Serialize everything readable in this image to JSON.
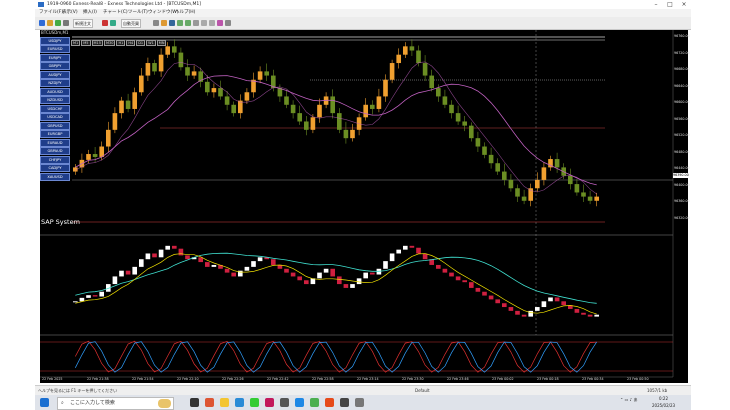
{
  "window": {
    "title": "1919-0960 Exness-Real8 - Exness Technologies Ltd - [BTCUSDm,M1]"
  },
  "menu": [
    "ファイル(F)",
    "表示(V)",
    "挿入(I)",
    "チャート(C)",
    "ツール(T)",
    "ウィンドウ(W)",
    "ヘルプ(H)"
  ],
  "toolbar": {
    "new_order": "新規注文",
    "auto_trade": "自動売買"
  },
  "chart": {
    "symbol_header": "BTCUSDm,M1",
    "overlay_label": "SAP System",
    "timeframes": [
      "M1",
      "M5",
      "M15",
      "M30",
      "H1",
      "H4",
      "D1",
      "W1",
      "MN"
    ],
    "symbols": [
      "USDJPY",
      "EURUSD",
      "EURJPY",
      "GBPJPY",
      "AUDJPY",
      "NZDJPY",
      "AUDUSD",
      "NZDUSD",
      "USDCHF",
      "USDCAD",
      "GBPUSD",
      "EURGBP",
      "EURAUD",
      "GBPAUD",
      "CHFJPY",
      "CADJPY",
      "XAUUSD"
    ],
    "price_ticks": [
      "96760.00",
      "96720.00",
      "96680.00",
      "96640.00",
      "96600.00",
      "96560.00",
      "96520.00",
      "96480.00",
      "96440.00",
      "96400.00",
      "96360.00",
      "96320.00"
    ],
    "last_price": "96390.00",
    "time_ticks": [
      "22 Feb 2025",
      "22 Feb 21:38",
      "22 Feb 21:54",
      "22 Feb 22:10",
      "22 Feb 22:26",
      "22 Feb 22:42",
      "22 Feb 22:58",
      "22 Feb 23:14",
      "22 Feb 23:30",
      "22 Feb 23:46",
      "23 Feb 00:02",
      "23 Feb 00:18",
      "23 Feb 00:34",
      "23 Feb 00:50"
    ],
    "colors": {
      "bull": "#f0a030",
      "bear": "#6b8e23",
      "ma_fast": "#f0e000",
      "ma_slow": "#c060c0",
      "band": "#40e0d0",
      "osc1": "#e03030",
      "osc2": "#30a0ff"
    }
  },
  "chart_data": {
    "type": "candlestick",
    "title": "BTCUSDm,M1",
    "close": [
      96470,
      96488,
      96502,
      96495,
      96520,
      96560,
      96600,
      96630,
      96610,
      96650,
      96690,
      96720,
      96700,
      96740,
      96760,
      96745,
      96710,
      96690,
      96700,
      96675,
      96650,
      96660,
      96640,
      96620,
      96600,
      96630,
      96650,
      96680,
      96700,
      96690,
      96660,
      96640,
      96620,
      96600,
      96580,
      96560,
      96590,
      96620,
      96640,
      96600,
      96560,
      96540,
      96560,
      96590,
      96620,
      96610,
      96640,
      96680,
      96720,
      96740,
      96760,
      96750,
      96720,
      96690,
      96660,
      96640,
      96620,
      96600,
      96580,
      96570,
      96540,
      96520,
      96500,
      96480,
      96460,
      96440,
      96420,
      96400,
      96390,
      96420,
      96440,
      96470,
      96490,
      96470,
      96450,
      96430,
      96410,
      96400,
      96390,
      96400
    ]
  },
  "status": {
    "help": "ヘルプを見るには F1 キーを押してください",
    "profile": "Default",
    "ping": "1057/1 kb"
  },
  "taskbar": {
    "search_placeholder": "ここに入力して検索",
    "time": "0:22",
    "date": "2025/02/23"
  }
}
